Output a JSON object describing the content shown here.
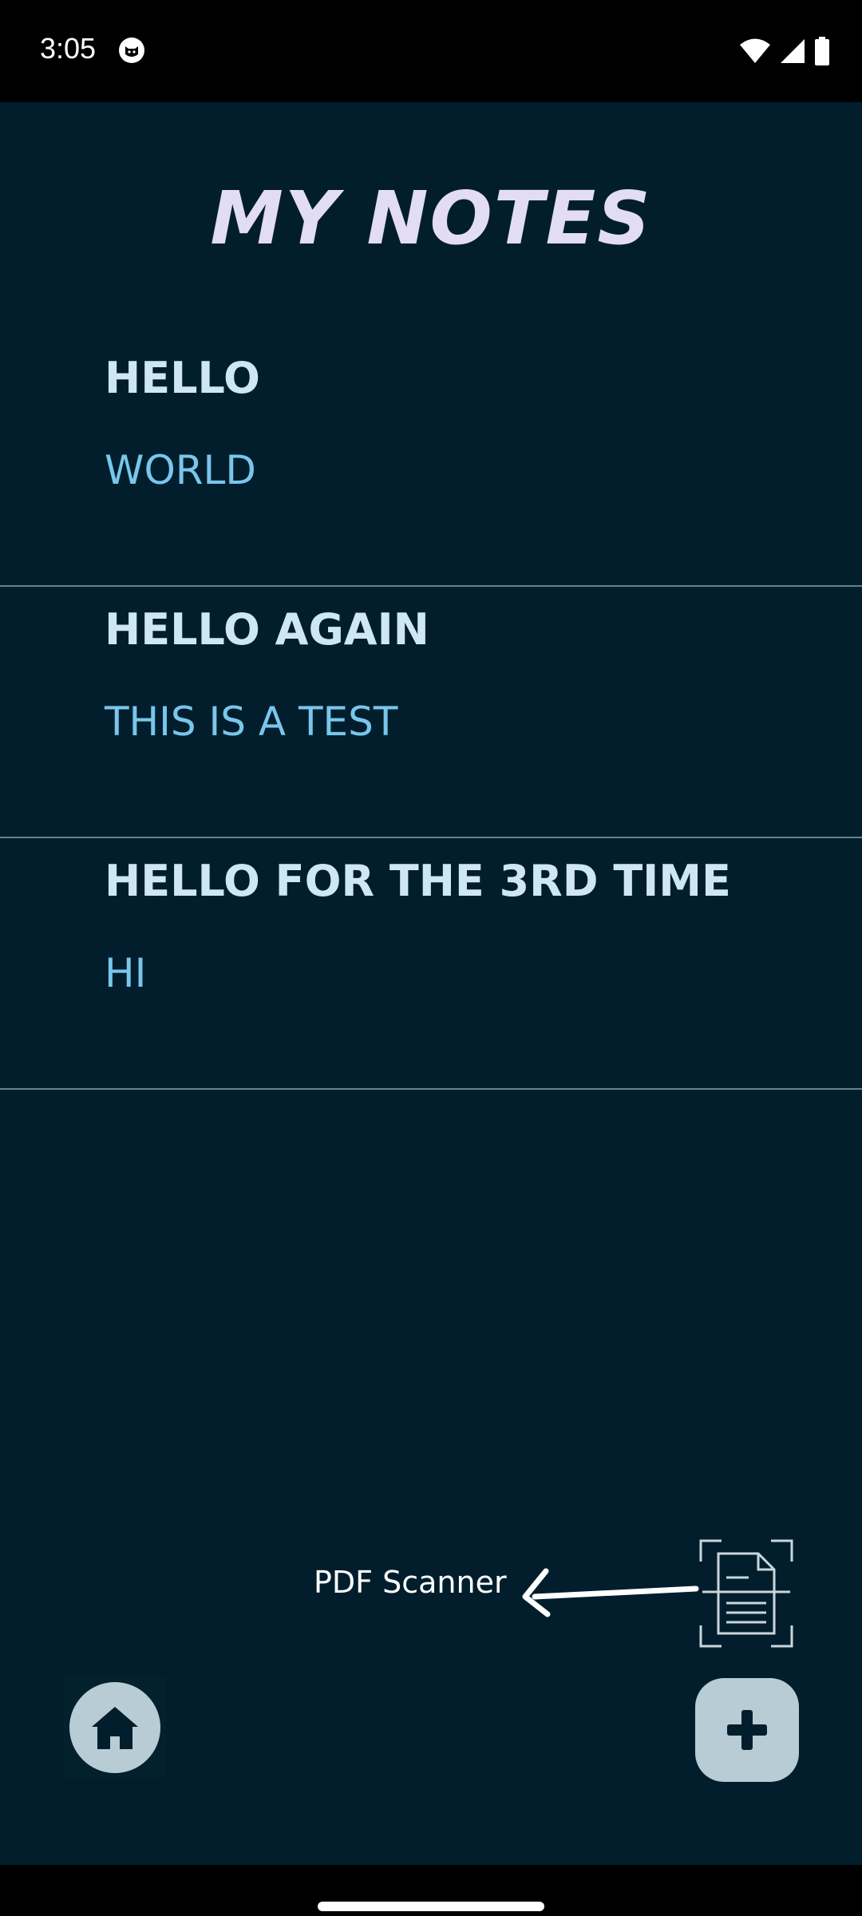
{
  "status_bar": {
    "time": "3:05",
    "icons": [
      "cat-icon",
      "wifi-icon",
      "cell-signal-icon",
      "battery-icon"
    ]
  },
  "app": {
    "title": "MY NOTES"
  },
  "notes": [
    {
      "title": "HELLO",
      "body": "WORLD"
    },
    {
      "title": "HELLO AGAIN",
      "body": "THIS IS A TEST"
    },
    {
      "title": "HELLO FOR THE 3RD TIME",
      "body": "HI"
    }
  ],
  "scanner": {
    "label": "PDF Scanner",
    "icon": "document-scanner-icon"
  },
  "bottom": {
    "home_icon": "home-icon",
    "add_icon": "plus-icon"
  },
  "colors": {
    "background": "#021e2c",
    "title": "#e3dcf7",
    "note_title": "#cfe6f5",
    "note_body": "#79c6ec",
    "button": "#b8ccd6"
  }
}
